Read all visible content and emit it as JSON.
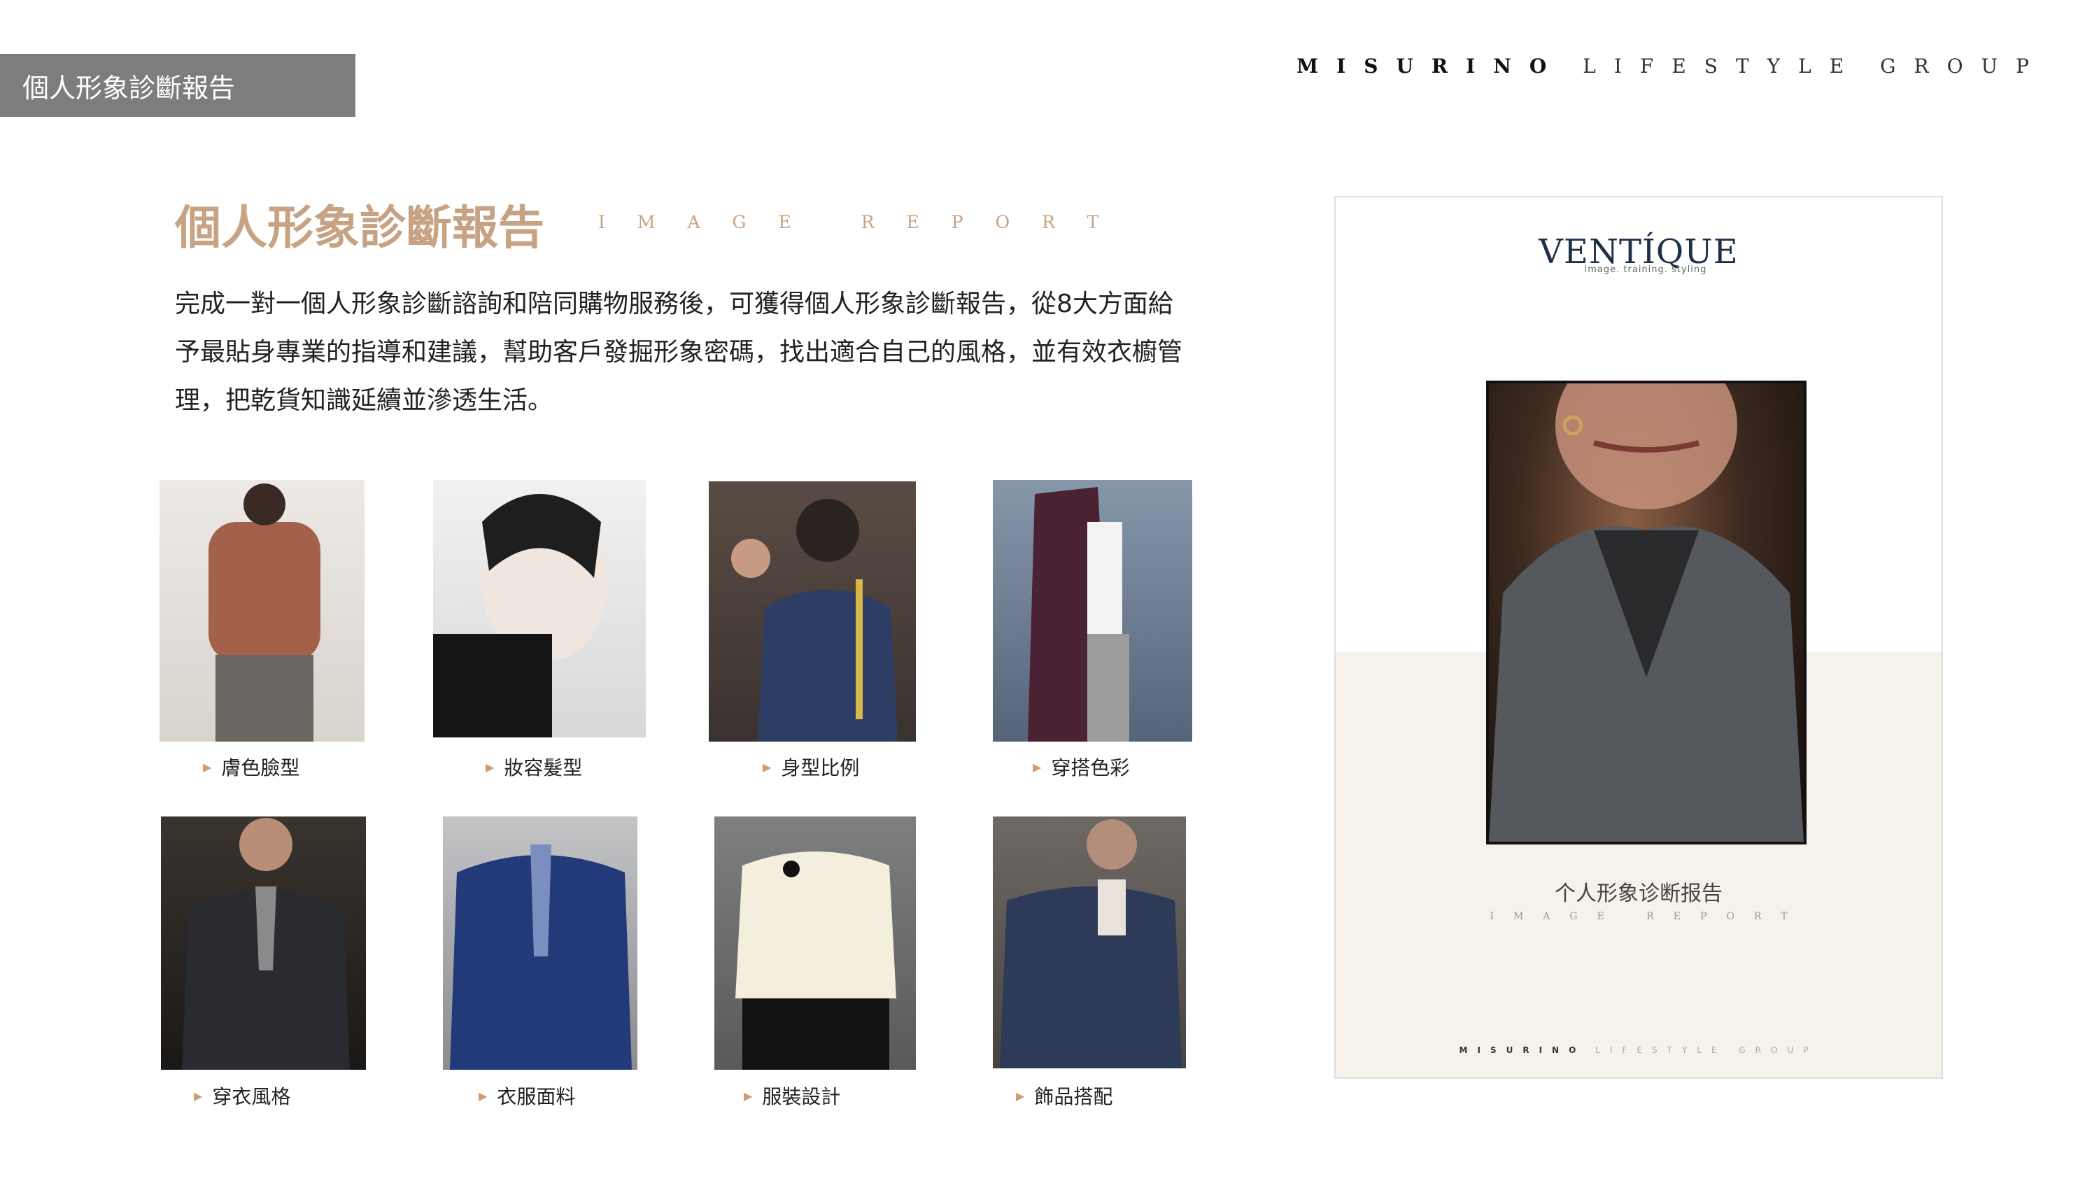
{
  "tag_label": "個人形象診斷報告",
  "brand": {
    "part1": "MISURINO",
    "part2": "LIFESTYLE",
    "part3": "GROUP"
  },
  "heading": "個人形象診斷報告",
  "heading_sub": "IMAGE REPORT",
  "intro": "完成一對一個人形象診斷諮詢和陪同購物服務後，可獲得個人形象診斷報告，從8大方面給予最貼身專業的指導和建議，幫助客戶發掘形象密碼，找出適合自己的風格，並有效衣櫥管理，把乾貨知識延續並滲透生活。",
  "tiles": [
    {
      "label": "膚色臉型"
    },
    {
      "label": "妝容髮型"
    },
    {
      "label": "身型比例"
    },
    {
      "label": "穿搭色彩"
    },
    {
      "label": "穿衣風格"
    },
    {
      "label": "衣服面料"
    },
    {
      "label": "服裝設計"
    },
    {
      "label": "飾品搭配"
    }
  ],
  "cover": {
    "logo": "VENTÍQUE",
    "tagline": "image. training. styling",
    "title": "个人形象诊断报告",
    "subtitle": "IMAGE REPORT",
    "brand1": "MISURINO",
    "brand2": "LIFESTYLE GROUP"
  },
  "colors": {
    "accent": "#c7a383",
    "tag_bg": "#7d7d7d",
    "arrow": "#d39b6b",
    "cover_lower": "#f6f1ea"
  }
}
